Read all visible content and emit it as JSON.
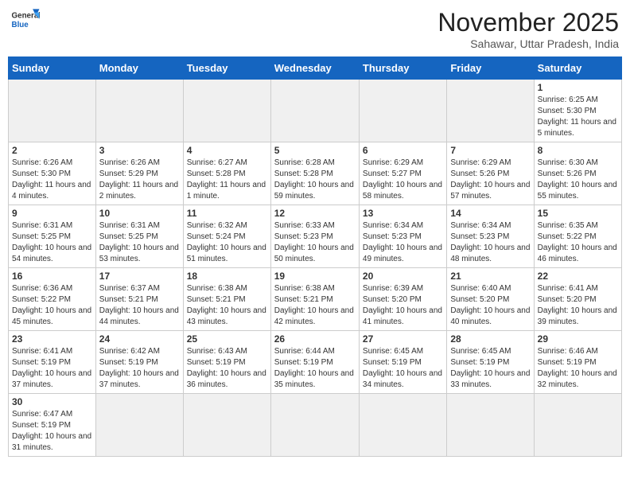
{
  "header": {
    "logo_general": "General",
    "logo_blue": "Blue",
    "title": "November 2025",
    "subtitle": "Sahawar, Uttar Pradesh, India"
  },
  "days_of_week": [
    "Sunday",
    "Monday",
    "Tuesday",
    "Wednesday",
    "Thursday",
    "Friday",
    "Saturday"
  ],
  "weeks": [
    [
      {
        "day": "",
        "info": ""
      },
      {
        "day": "",
        "info": ""
      },
      {
        "day": "",
        "info": ""
      },
      {
        "day": "",
        "info": ""
      },
      {
        "day": "",
        "info": ""
      },
      {
        "day": "",
        "info": ""
      },
      {
        "day": "1",
        "info": "Sunrise: 6:25 AM\nSunset: 5:30 PM\nDaylight: 11 hours and 5 minutes."
      }
    ],
    [
      {
        "day": "2",
        "info": "Sunrise: 6:26 AM\nSunset: 5:30 PM\nDaylight: 11 hours and 4 minutes."
      },
      {
        "day": "3",
        "info": "Sunrise: 6:26 AM\nSunset: 5:29 PM\nDaylight: 11 hours and 2 minutes."
      },
      {
        "day": "4",
        "info": "Sunrise: 6:27 AM\nSunset: 5:28 PM\nDaylight: 11 hours and 1 minute."
      },
      {
        "day": "5",
        "info": "Sunrise: 6:28 AM\nSunset: 5:28 PM\nDaylight: 10 hours and 59 minutes."
      },
      {
        "day": "6",
        "info": "Sunrise: 6:29 AM\nSunset: 5:27 PM\nDaylight: 10 hours and 58 minutes."
      },
      {
        "day": "7",
        "info": "Sunrise: 6:29 AM\nSunset: 5:26 PM\nDaylight: 10 hours and 57 minutes."
      },
      {
        "day": "8",
        "info": "Sunrise: 6:30 AM\nSunset: 5:26 PM\nDaylight: 10 hours and 55 minutes."
      }
    ],
    [
      {
        "day": "9",
        "info": "Sunrise: 6:31 AM\nSunset: 5:25 PM\nDaylight: 10 hours and 54 minutes."
      },
      {
        "day": "10",
        "info": "Sunrise: 6:31 AM\nSunset: 5:25 PM\nDaylight: 10 hours and 53 minutes."
      },
      {
        "day": "11",
        "info": "Sunrise: 6:32 AM\nSunset: 5:24 PM\nDaylight: 10 hours and 51 minutes."
      },
      {
        "day": "12",
        "info": "Sunrise: 6:33 AM\nSunset: 5:23 PM\nDaylight: 10 hours and 50 minutes."
      },
      {
        "day": "13",
        "info": "Sunrise: 6:34 AM\nSunset: 5:23 PM\nDaylight: 10 hours and 49 minutes."
      },
      {
        "day": "14",
        "info": "Sunrise: 6:34 AM\nSunset: 5:23 PM\nDaylight: 10 hours and 48 minutes."
      },
      {
        "day": "15",
        "info": "Sunrise: 6:35 AM\nSunset: 5:22 PM\nDaylight: 10 hours and 46 minutes."
      }
    ],
    [
      {
        "day": "16",
        "info": "Sunrise: 6:36 AM\nSunset: 5:22 PM\nDaylight: 10 hours and 45 minutes."
      },
      {
        "day": "17",
        "info": "Sunrise: 6:37 AM\nSunset: 5:21 PM\nDaylight: 10 hours and 44 minutes."
      },
      {
        "day": "18",
        "info": "Sunrise: 6:38 AM\nSunset: 5:21 PM\nDaylight: 10 hours and 43 minutes."
      },
      {
        "day": "19",
        "info": "Sunrise: 6:38 AM\nSunset: 5:21 PM\nDaylight: 10 hours and 42 minutes."
      },
      {
        "day": "20",
        "info": "Sunrise: 6:39 AM\nSunset: 5:20 PM\nDaylight: 10 hours and 41 minutes."
      },
      {
        "day": "21",
        "info": "Sunrise: 6:40 AM\nSunset: 5:20 PM\nDaylight: 10 hours and 40 minutes."
      },
      {
        "day": "22",
        "info": "Sunrise: 6:41 AM\nSunset: 5:20 PM\nDaylight: 10 hours and 39 minutes."
      }
    ],
    [
      {
        "day": "23",
        "info": "Sunrise: 6:41 AM\nSunset: 5:19 PM\nDaylight: 10 hours and 37 minutes."
      },
      {
        "day": "24",
        "info": "Sunrise: 6:42 AM\nSunset: 5:19 PM\nDaylight: 10 hours and 37 minutes."
      },
      {
        "day": "25",
        "info": "Sunrise: 6:43 AM\nSunset: 5:19 PM\nDaylight: 10 hours and 36 minutes."
      },
      {
        "day": "26",
        "info": "Sunrise: 6:44 AM\nSunset: 5:19 PM\nDaylight: 10 hours and 35 minutes."
      },
      {
        "day": "27",
        "info": "Sunrise: 6:45 AM\nSunset: 5:19 PM\nDaylight: 10 hours and 34 minutes."
      },
      {
        "day": "28",
        "info": "Sunrise: 6:45 AM\nSunset: 5:19 PM\nDaylight: 10 hours and 33 minutes."
      },
      {
        "day": "29",
        "info": "Sunrise: 6:46 AM\nSunset: 5:19 PM\nDaylight: 10 hours and 32 minutes."
      }
    ],
    [
      {
        "day": "30",
        "info": "Sunrise: 6:47 AM\nSunset: 5:19 PM\nDaylight: 10 hours and 31 minutes."
      },
      {
        "day": "",
        "info": ""
      },
      {
        "day": "",
        "info": ""
      },
      {
        "day": "",
        "info": ""
      },
      {
        "day": "",
        "info": ""
      },
      {
        "day": "",
        "info": ""
      },
      {
        "day": "",
        "info": ""
      }
    ]
  ]
}
